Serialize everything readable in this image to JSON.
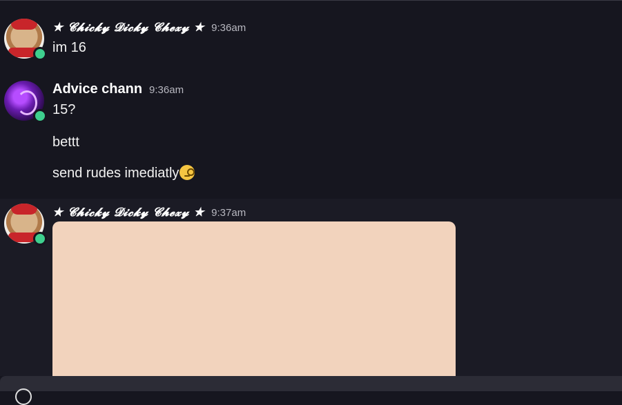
{
  "messages": [
    {
      "author": "★ 𝓒𝓱𝓲𝓬𝓴𝔂 𝓓𝓲𝓬𝓴𝔂 𝓒𝓱𝓮𝔁𝔂 ★",
      "time": "9:36am",
      "lines": [
        "im 16"
      ]
    },
    {
      "author": "Advice chann",
      "time": "9:36am",
      "lines": [
        "15?",
        "bettt",
        "send rudes imediatly"
      ]
    },
    {
      "author": "★ 𝓒𝓱𝓲𝓬𝓴𝔂 𝓓𝓲𝓬𝓴𝔂 𝓒𝓱𝓮𝔁𝔂 ★",
      "time": "9:37am",
      "attachment": "image"
    }
  ],
  "colors": {
    "background": "#16161f",
    "online": "#3ecf8e",
    "attachment": "#f2d3bd",
    "timestamp": "#b8b8c0"
  },
  "icons": {
    "status": "online-status-icon",
    "emoji": "face-with-monocle-icon"
  }
}
